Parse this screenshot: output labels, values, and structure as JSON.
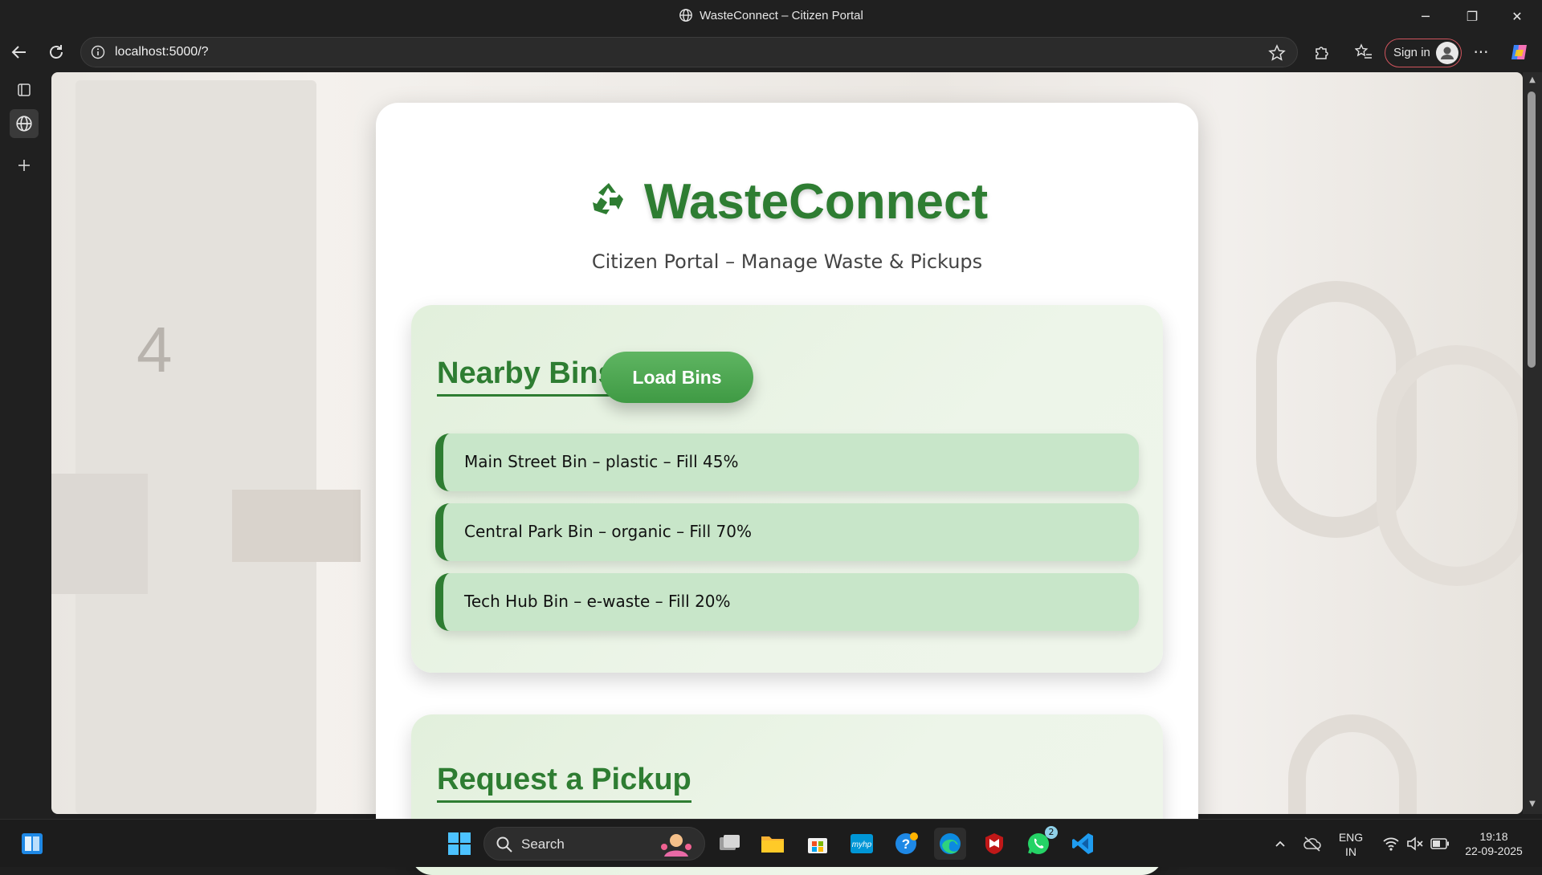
{
  "window": {
    "title": "WasteConnect – Citizen Portal",
    "minimize": "─",
    "maximize": "❐",
    "close": "✕"
  },
  "browser": {
    "url": "localhost:5000/?",
    "signin_label": "Sign in",
    "more": "···"
  },
  "app": {
    "brand": "WasteConnect",
    "subtitle": "Citizen Portal – Manage Waste & Pickups",
    "bins_section": {
      "heading": "Nearby Bins",
      "load_button": "Load Bins",
      "items": [
        "Main Street Bin – plastic – Fill 45%",
        "Central Park Bin – organic – Fill 70%",
        "Tech Hub Bin – e-waste – Fill 20%"
      ]
    },
    "pickup_section": {
      "heading": "Request a Pickup"
    },
    "colors": {
      "primary_green": "#2e7d32",
      "item_bg": "#c8e6c9",
      "button_green": "#4caf50"
    }
  },
  "taskbar": {
    "search_label": "Search",
    "whatsapp_badge": "2",
    "lang_top": "ENG",
    "lang_bottom": "IN",
    "time": "19:18",
    "date": "22-09-2025"
  }
}
